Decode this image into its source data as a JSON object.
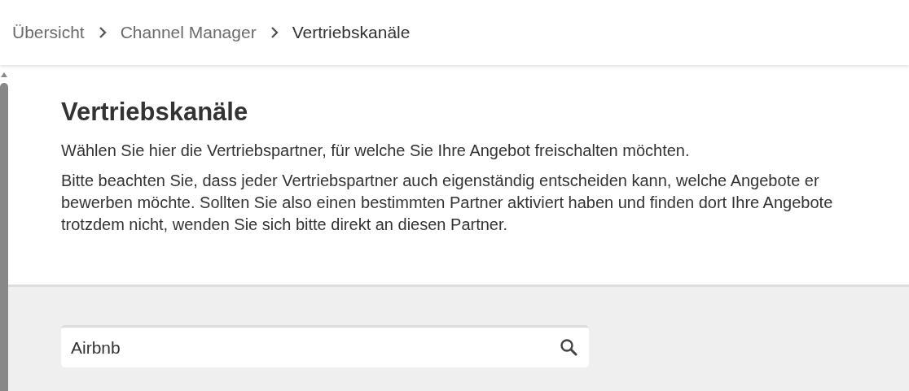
{
  "breadcrumb": [
    {
      "label": "Übersicht"
    },
    {
      "label": "Channel Manager"
    },
    {
      "label": "Vertriebskanäle"
    }
  ],
  "page": {
    "title": "Vertriebskanäle",
    "paragraphs": [
      "Wählen Sie hier die Vertriebspartner, für welche Sie Ihre Angebot freischalten möchten.",
      "Bitte beachten Sie, dass jeder Vertriebspartner auch eigenständig entscheiden kann, welche Angebote er bewerben möchte. Sollten Sie also einen bestimmten Partner aktiviert haben und finden dort Ihre Angebote trotzdem nicht, wenden Sie sich bitte direkt an diesen Partner."
    ]
  },
  "search": {
    "value": "Airbnb"
  }
}
